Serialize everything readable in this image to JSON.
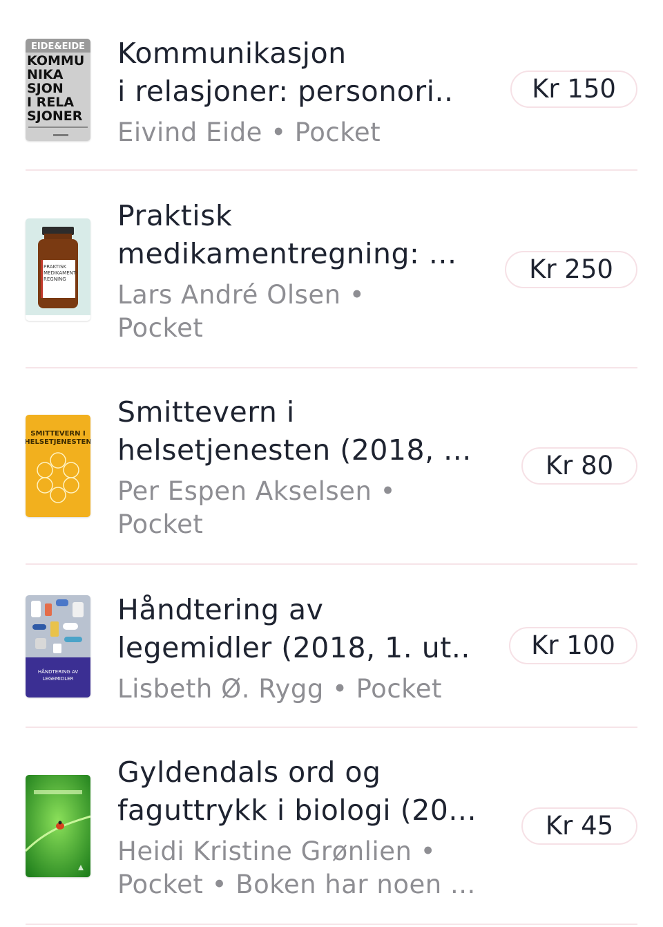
{
  "items": [
    {
      "title_line1": "Kommunikasjon",
      "title_line2": "i relasjoner: personori..",
      "meta_line1": "Eivind Eide • Pocket",
      "meta_line2": "",
      "price": "Kr 150",
      "cover": {
        "icon": "book-cover-kommunikasjon",
        "publisher_band": "EIDE&EIDE",
        "lines": [
          "KOMMU",
          "NIKA",
          "SJON",
          "I RELA",
          "SJONER"
        ],
        "colors": {
          "bg": "#cfcfcf",
          "band": "#9a9a9a",
          "text": "#111111"
        }
      }
    },
    {
      "title_line1": "Praktisk",
      "title_line2": "medikamentregning: ...",
      "meta_line1": "Lars André Olsen •",
      "meta_line2": "Pocket",
      "price": "Kr 250",
      "cover": {
        "icon": "book-cover-medicine-bottle",
        "label_lines": [
          "PRAKTISK",
          "MEDIKAMENT-",
          "REGNING"
        ],
        "colors": {
          "bg": "#d8ebe8",
          "bottle": "#7a3a12",
          "label": "#ffffff",
          "accent": "#c0392b"
        }
      }
    },
    {
      "title_line1": "Smittevern i",
      "title_line2": "helsetjenesten (2018, ...",
      "meta_line1": "Per Espen Akselsen •",
      "meta_line2": "Pocket",
      "price": "Kr 80",
      "cover": {
        "icon": "book-cover-smittevern",
        "lines": [
          "SMITTEVERN I",
          "HELSETJENESTEN"
        ],
        "colors": {
          "bg": "#f2b01e",
          "text": "#3a2a00",
          "diagram": "#fff3c4"
        }
      }
    },
    {
      "title_line1": "Håndtering av",
      "title_line2": "legemidler (2018, 1. ut..",
      "meta_line1": "Lisbeth Ø. Rygg • Pocket",
      "meta_line2": "",
      "price": "Kr 100",
      "cover": {
        "icon": "book-cover-pills",
        "lines": [
          "HÅNDTERING AV",
          "LEGEMIDLER"
        ],
        "colors": {
          "top": "#b9c2d0",
          "bottom": "#3b2f93",
          "text": "#ffffff"
        }
      }
    },
    {
      "title_line1": "Gyldendals ord og",
      "title_line2": "faguttrykk i biologi (20...",
      "meta_line1": "Heidi Kristine Grønlien •",
      "meta_line2": "Pocket • Boken har noen ...",
      "price": "Kr 45",
      "cover": {
        "icon": "book-cover-ladybug-leaf",
        "colors": {
          "bg": "#2fa52a",
          "light": "#8be05a",
          "bug": "#d7431f"
        }
      }
    }
  ],
  "colors": {
    "title": "#1e2330",
    "meta": "#8e8e93",
    "price_border": "#f6e1e6",
    "divider": "#f6e4e8"
  }
}
